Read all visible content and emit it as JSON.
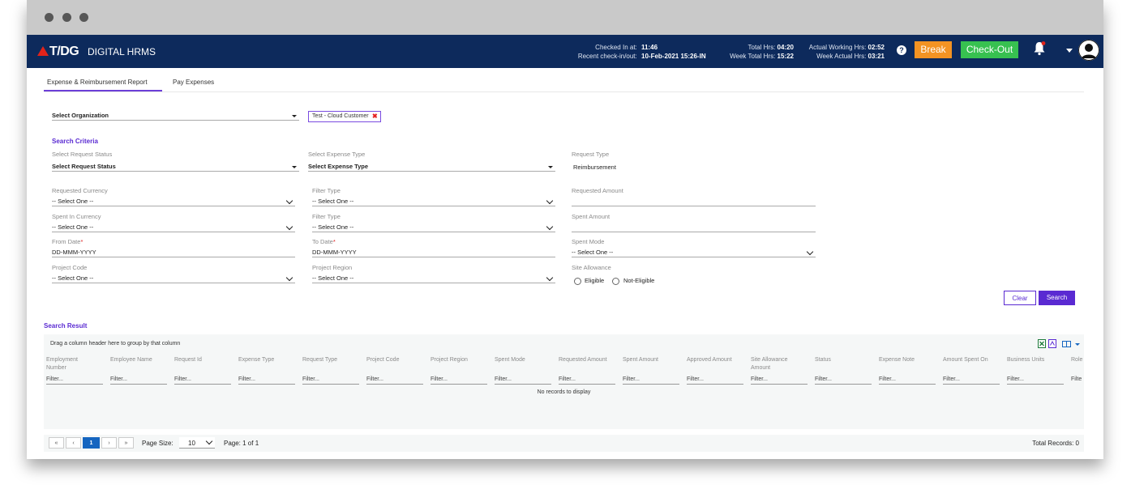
{
  "topbar": {
    "logo": "T/DG",
    "app_name": "DIGITAL HRMS",
    "checked_in_label": "Checked In at:",
    "checked_in_value": "11:46",
    "recent_label": "Recent check-in/out:",
    "recent_value": "10-Feb-2021 15:26-IN",
    "total_hrs_label": "Total Hrs:",
    "total_hrs_value": "04:20",
    "week_total_label": "Week Total Hrs:",
    "week_total_value": "15:22",
    "actual_label": "Actual Working Hrs:",
    "actual_value": "02:52",
    "week_actual_label": "Week Actual Hrs:",
    "week_actual_value": "03:21",
    "help": "?",
    "break_label": "Break",
    "checkout_label": "Check-Out"
  },
  "tabs": [
    "Expense & Reimbursement Report",
    "Pay Expenses"
  ],
  "org": {
    "select_label": "Select Organization",
    "chip": "Test - Cloud Customer"
  },
  "criteria": {
    "title": "Search Criteria",
    "request_status_label": "Select Request Status",
    "request_status_value": "Select Request Status",
    "expense_type_label": "Select Expense Type",
    "expense_type_value": "Select Expense Type",
    "request_type_label": "Request Type",
    "request_type_value": "Reimbursement",
    "requested_currency_label": "Requested Currency",
    "requested_currency_value": "-- Select One --",
    "filter_type1_label": "Filter Type",
    "filter_type1_value": "-- Select One --",
    "requested_amount_label": "Requested Amount",
    "spent_currency_label": "Spent In Currency",
    "spent_currency_value": "-- Select One --",
    "filter_type2_label": "Filter Type",
    "filter_type2_value": "-- Select One --",
    "spent_amount_label": "Spent Amount",
    "from_date_label": "From Date",
    "from_date_value": "DD-MMM-YYYY",
    "to_date_label": "To Date",
    "to_date_value": "DD-MMM-YYYY",
    "spent_mode_label": "Spent Mode",
    "spent_mode_value": "-- Select One --",
    "project_code_label": "Project Code",
    "project_code_value": "-- Select One --",
    "project_region_label": "Project Region",
    "project_region_value": "-- Select One --",
    "site_allowance_label": "Site Allowance",
    "eligible": "Eligible",
    "not_eligible": "Not-Eligible",
    "required_mark": "*",
    "clear_label": "Clear",
    "search_label": "Search"
  },
  "result": {
    "title": "Search Result",
    "group_hint": "Drag a column header here to group by that column",
    "columns": [
      [
        "Employment",
        "Number"
      ],
      [
        "Employee Name",
        ""
      ],
      [
        "Request Id",
        ""
      ],
      [
        "Expense Type",
        ""
      ],
      [
        "Request Type",
        ""
      ],
      [
        "Project Code",
        ""
      ],
      [
        "Project Region",
        ""
      ],
      [
        "Spent Mode",
        ""
      ],
      [
        "Requested Amount",
        ""
      ],
      [
        "Spent Amount",
        ""
      ],
      [
        "Approved Amount",
        ""
      ],
      [
        "Site Allowance",
        "Amount"
      ],
      [
        "Status",
        ""
      ],
      [
        "Expense Note",
        ""
      ],
      [
        "Amount Spent On",
        ""
      ],
      [
        "Business Units",
        ""
      ],
      [
        "Role",
        ""
      ]
    ],
    "filter_placeholder": "Filter...",
    "last_filter": "Filte",
    "no_records": "No records to display"
  },
  "pager": {
    "first": "«",
    "prev": "‹",
    "page": "1",
    "next": "›",
    "last": "»",
    "page_size_label": "Page Size:",
    "page_size": "10",
    "page_info": "Page: 1 of 1",
    "total": "Total Records: 0"
  },
  "colors": {
    "topbar": "#0d2a5c",
    "accent": "#5a2ad2",
    "break": "#f39323",
    "checkout": "#37c150"
  }
}
